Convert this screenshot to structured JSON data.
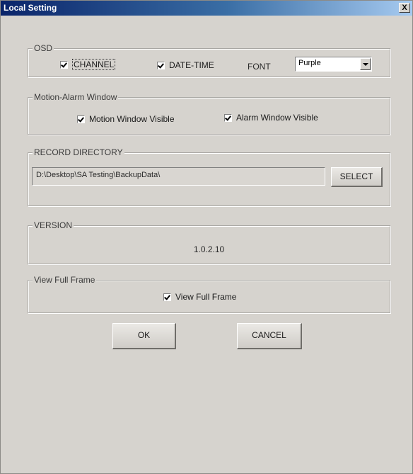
{
  "window": {
    "title": "Local Setting",
    "close_glyph": "X"
  },
  "osd": {
    "legend": "OSD",
    "channel_label": "CHANNEL",
    "channel_checked": true,
    "datetime_label": "DATE-TIME",
    "datetime_checked": true,
    "font_label": "FONT",
    "font_value": "Purple"
  },
  "motion_alarm": {
    "legend": "Motion-Alarm Window",
    "motion_label": "Motion Window Visible",
    "motion_checked": true,
    "alarm_label": "Alarm Window Visible",
    "alarm_checked": true
  },
  "record": {
    "legend": "RECORD DIRECTORY",
    "path": "D:\\Desktop\\SA Testing\\BackupData\\",
    "select_label": "SELECT"
  },
  "version": {
    "legend": "VERSION",
    "value": "1.0.2.10"
  },
  "full_frame": {
    "legend": "View Full Frame",
    "checkbox_label": "View Full Frame",
    "checked": true
  },
  "buttons": {
    "ok": "OK",
    "cancel": "CANCEL"
  },
  "icons": {
    "close": "close-icon",
    "check": "checkmark-icon",
    "dropdown": "chevron-down-icon"
  }
}
